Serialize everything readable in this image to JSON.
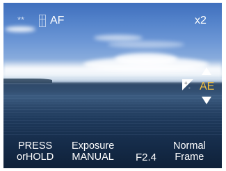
{
  "screen": {
    "flash_mode": "**",
    "focus_mode": "AF",
    "zoom": "x2",
    "ae_label": "AE",
    "ae_color": "#f5c242",
    "mode_line1": "PRESS",
    "mode_line2": "orHOLD",
    "exposure_line1": "Exposure",
    "exposure_line2": "MANUAL",
    "aperture": "F2.4",
    "frame_line1": "Normal",
    "frame_line2": "Frame"
  },
  "icons": {
    "flash_box": "grid-box-icon",
    "exposure_comp": "exposure-compensation-icon",
    "ae_up": "arrow-up-icon",
    "ae_down": "arrow-down-icon"
  }
}
